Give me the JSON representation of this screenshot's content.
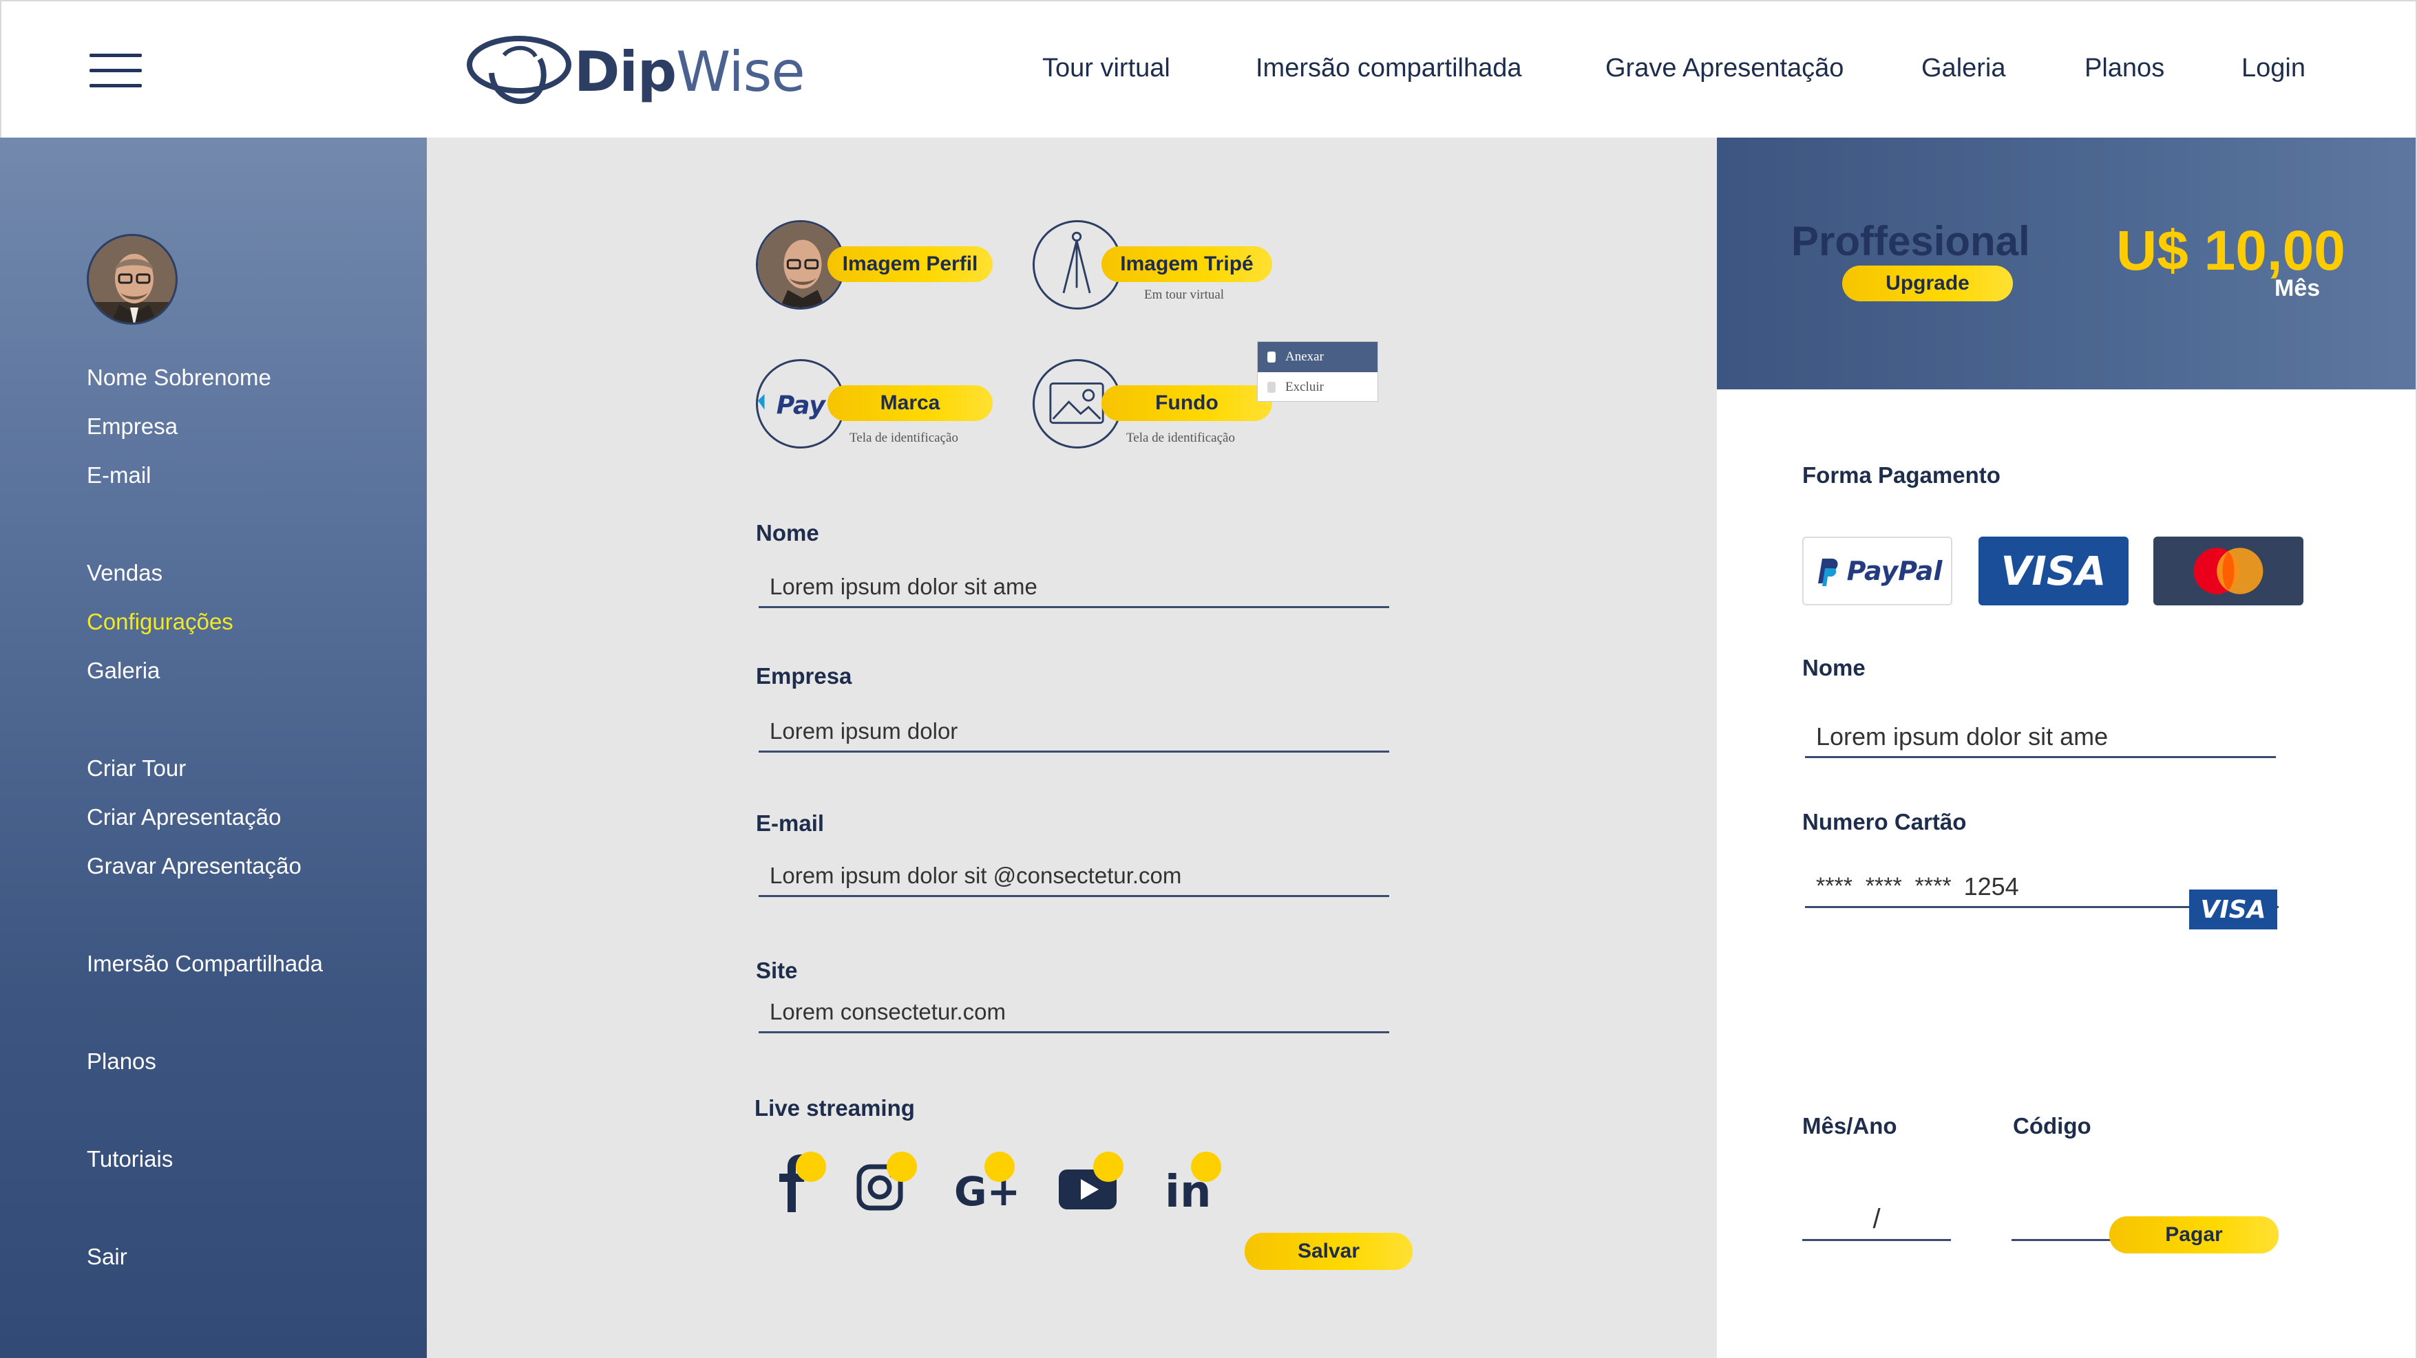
{
  "header": {
    "logo_text_part1": "Dip",
    "logo_text_part2": "Wise",
    "nav": [
      "Tour virtual",
      "Imersão compartilhada",
      "Grave Apresentação",
      "Galeria",
      "Planos",
      "Login"
    ]
  },
  "sidebar": {
    "items": [
      "Nome Sobrenome",
      "Empresa",
      "E-mail",
      "Vendas",
      "Configurações",
      "Galeria",
      "Criar Tour",
      "Criar Apresentação",
      "Gravar Apresentação",
      "Imersão Compartilhada",
      "Planos",
      "Tutoriais",
      "Sair"
    ],
    "active_item": "Configurações"
  },
  "media": {
    "profile_label": "Imagem Perfil",
    "tripod_label": "Imagem Tripé",
    "tripod_caption": "Em tour virtual",
    "brand_label": "Marca",
    "brand_caption": "Tela de identificação",
    "background_label": "Fundo",
    "background_caption": "Tela de identificação",
    "brand_logo_text": "Pay"
  },
  "context_menu": {
    "items": [
      "Anexar",
      "Excluir"
    ]
  },
  "form": {
    "nome_label": "Nome",
    "nome_value": "Lorem ipsum dolor sit ame",
    "empresa_label": "Empresa",
    "empresa_value": "Lorem ipsum dolor",
    "email_label": "E-mail",
    "email_value": "Lorem ipsum dolor sit @consectetur.com",
    "site_label": "Site",
    "site_value": "Lorem consectetur.com",
    "live_label": "Live streaming",
    "save_label": "Salvar"
  },
  "social": [
    "facebook-icon",
    "instagram-icon",
    "google-plus-icon",
    "youtube-icon",
    "linkedin-icon"
  ],
  "plan": {
    "name": "Proffesional",
    "upgrade_label": "Upgrade",
    "price": "U$ 10,00",
    "period": "Mês"
  },
  "payment": {
    "title": "Forma Pagamento",
    "paypal_text": "PayPal",
    "visa_text": "VISA",
    "nome_label": "Nome",
    "nome_value": "Lorem ipsum dolor sit ame",
    "card_label": "Numero Cartão",
    "card_masked": "****  ****  ****",
    "card_last": "1254",
    "card_brand": "VISA",
    "month_year_label": "Mês/Ano",
    "month_year_sep": "/",
    "code_label": "Código",
    "pay_label": "Pagar"
  },
  "colors": {
    "accent_yellow": "#ffd400",
    "navy": "#23355e",
    "sidebar_top": "#7389ad",
    "sidebar_bottom": "#324a76",
    "active_link": "#f2e82a"
  }
}
